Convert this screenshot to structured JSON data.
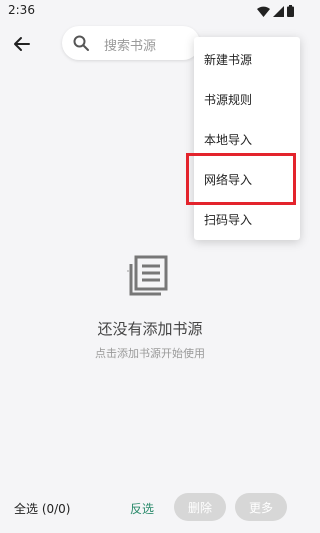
{
  "status_bar": {
    "time": "2:36"
  },
  "search": {
    "placeholder": "搜索书源"
  },
  "empty_state": {
    "title": "还没有添加书源",
    "subtitle": "点击添加书源开始使用"
  },
  "menu": {
    "items": [
      {
        "label": "新建书源"
      },
      {
        "label": "书源规则"
      },
      {
        "label": "本地导入"
      },
      {
        "label": "网络导入"
      },
      {
        "label": "扫码导入"
      }
    ]
  },
  "bottom_bar": {
    "select_all": "全选 (0/0)",
    "invert": "反选",
    "delete": "删除",
    "more": "更多"
  },
  "colors": {
    "accent": "#2a8a6b",
    "highlight": "#e3232c",
    "disabled_button": "#d7d7d7"
  }
}
